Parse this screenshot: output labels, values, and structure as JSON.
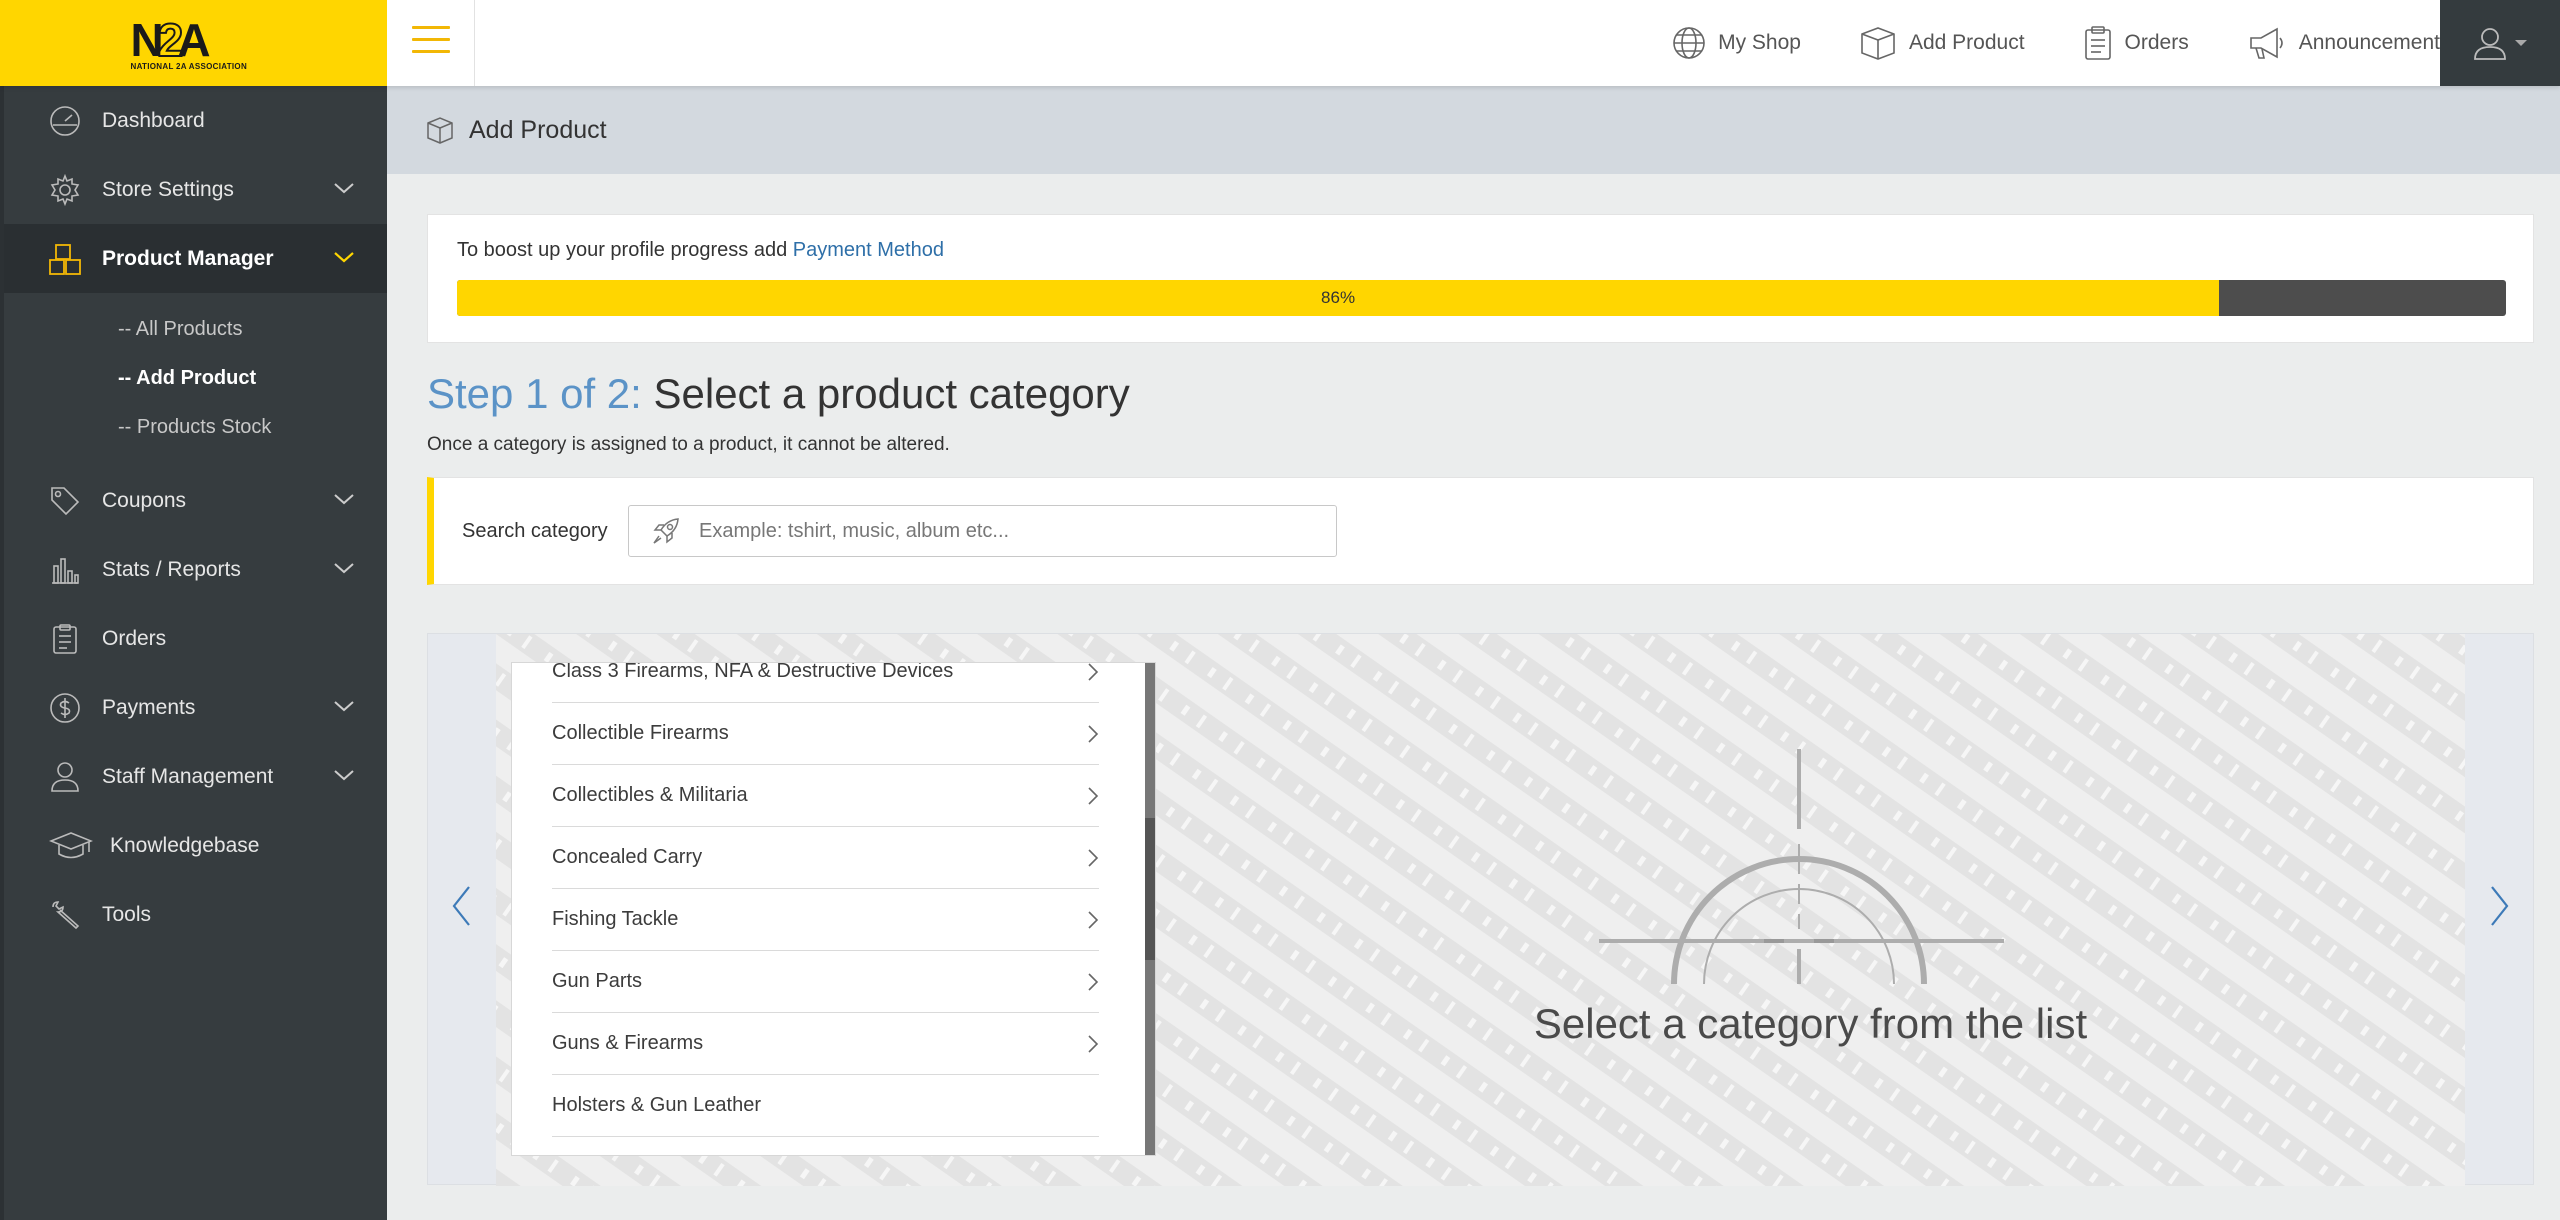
{
  "header": {
    "logo_big": "N2A",
    "logo_small": "NATIONAL 2A ASSOCIATION",
    "nav": [
      {
        "label": "My Shop",
        "icon": "globe-icon"
      },
      {
        "label": "Add Product",
        "icon": "box-icon"
      },
      {
        "label": "Orders",
        "icon": "clipboard-icon"
      },
      {
        "label": "Announcement",
        "icon": "megaphone-icon"
      }
    ]
  },
  "sidebar": {
    "items": [
      {
        "label": "Dashboard",
        "icon": "dashboard-icon"
      },
      {
        "label": "Store Settings",
        "icon": "gear-icon"
      },
      {
        "label": "Product Manager",
        "icon": "cubes-icon"
      },
      {
        "label": "Coupons",
        "icon": "tag-icon"
      },
      {
        "label": "Stats / Reports",
        "icon": "bar-chart-icon"
      },
      {
        "label": "Orders",
        "icon": "clipboard-icon"
      },
      {
        "label": "Payments",
        "icon": "dollar-icon"
      },
      {
        "label": "Staff Management",
        "icon": "user-icon"
      },
      {
        "label": "Knowledgebase",
        "icon": "graduation-cap-icon"
      },
      {
        "label": "Tools",
        "icon": "wrench-icon"
      }
    ],
    "submenu": [
      "-- All Products",
      "-- Add Product",
      "-- Products Stock"
    ]
  },
  "page": {
    "title": "Add Product"
  },
  "progress": {
    "message": "To boost up your profile progress add",
    "link": "Payment Method",
    "percent": 86,
    "percent_label": "86%"
  },
  "step": {
    "label": "Step 1 of 2:",
    "title": "Select a product category",
    "note": "Once a category is assigned to a product, it cannot be altered."
  },
  "search": {
    "label": "Search category",
    "placeholder": "Example: tshirt, music, album etc..."
  },
  "categories": [
    {
      "label": "Class 3 Firearms, NFA & Destructive Devices",
      "has_children": true
    },
    {
      "label": "Collectible Firearms",
      "has_children": true
    },
    {
      "label": "Collectibles & Militaria",
      "has_children": true
    },
    {
      "label": "Concealed Carry",
      "has_children": true
    },
    {
      "label": "Fishing Tackle",
      "has_children": true
    },
    {
      "label": "Gun Parts",
      "has_children": true
    },
    {
      "label": "Guns & Firearms",
      "has_children": true
    },
    {
      "label": "Holsters & Gun Leather",
      "has_children": false
    },
    {
      "label": "",
      "has_children": true
    }
  ],
  "empty_state": {
    "text": "Select a category from the list"
  },
  "colors": {
    "brand_yellow": "#ffd600",
    "sidebar_bg": "#363c3f",
    "accent_blue": "#5b93c7",
    "link_blue": "#2e6fa8"
  }
}
